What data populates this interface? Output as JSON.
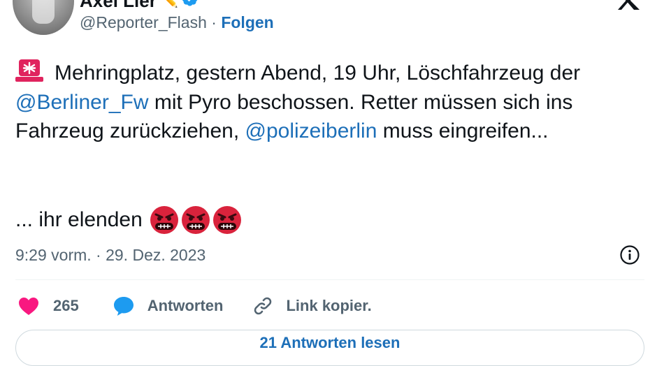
{
  "author": {
    "name": "Axel Lier",
    "handle": "@Reporter_Flash",
    "separator": "·",
    "follow_label": "Folgen"
  },
  "tweet": {
    "siren_icon": "rotating-light-icon",
    "text_part1": "Mehringplatz, gestern Abend, 19 Uhr, Löschfahrzeug der ",
    "mention1": "@Berliner_Fw",
    "text_part2": " mit Pyro beschossen. Retter müssen sich ins Fahrzeug zurückziehen, ",
    "mention2": "@polizeiberlin",
    "text_part3": " muss eingreifen...",
    "closing_text": "... ihr elenden",
    "closing_emojis": [
      "angry-symbols-face-icon",
      "angry-symbols-face-icon",
      "angry-symbols-face-icon"
    ],
    "timestamp": "9:29 vorm. · 29. Dez. 2023"
  },
  "actions": {
    "like_count": "265",
    "reply_label": "Antworten",
    "copy_label": "Link kopier."
  },
  "read_replies_label": "21 Antworten lesen",
  "colors": {
    "link": "#1d6fb8",
    "secondary_text": "#536471",
    "like": "#f91880",
    "reply": "#1d9bf0",
    "siren": "#e0245e"
  }
}
